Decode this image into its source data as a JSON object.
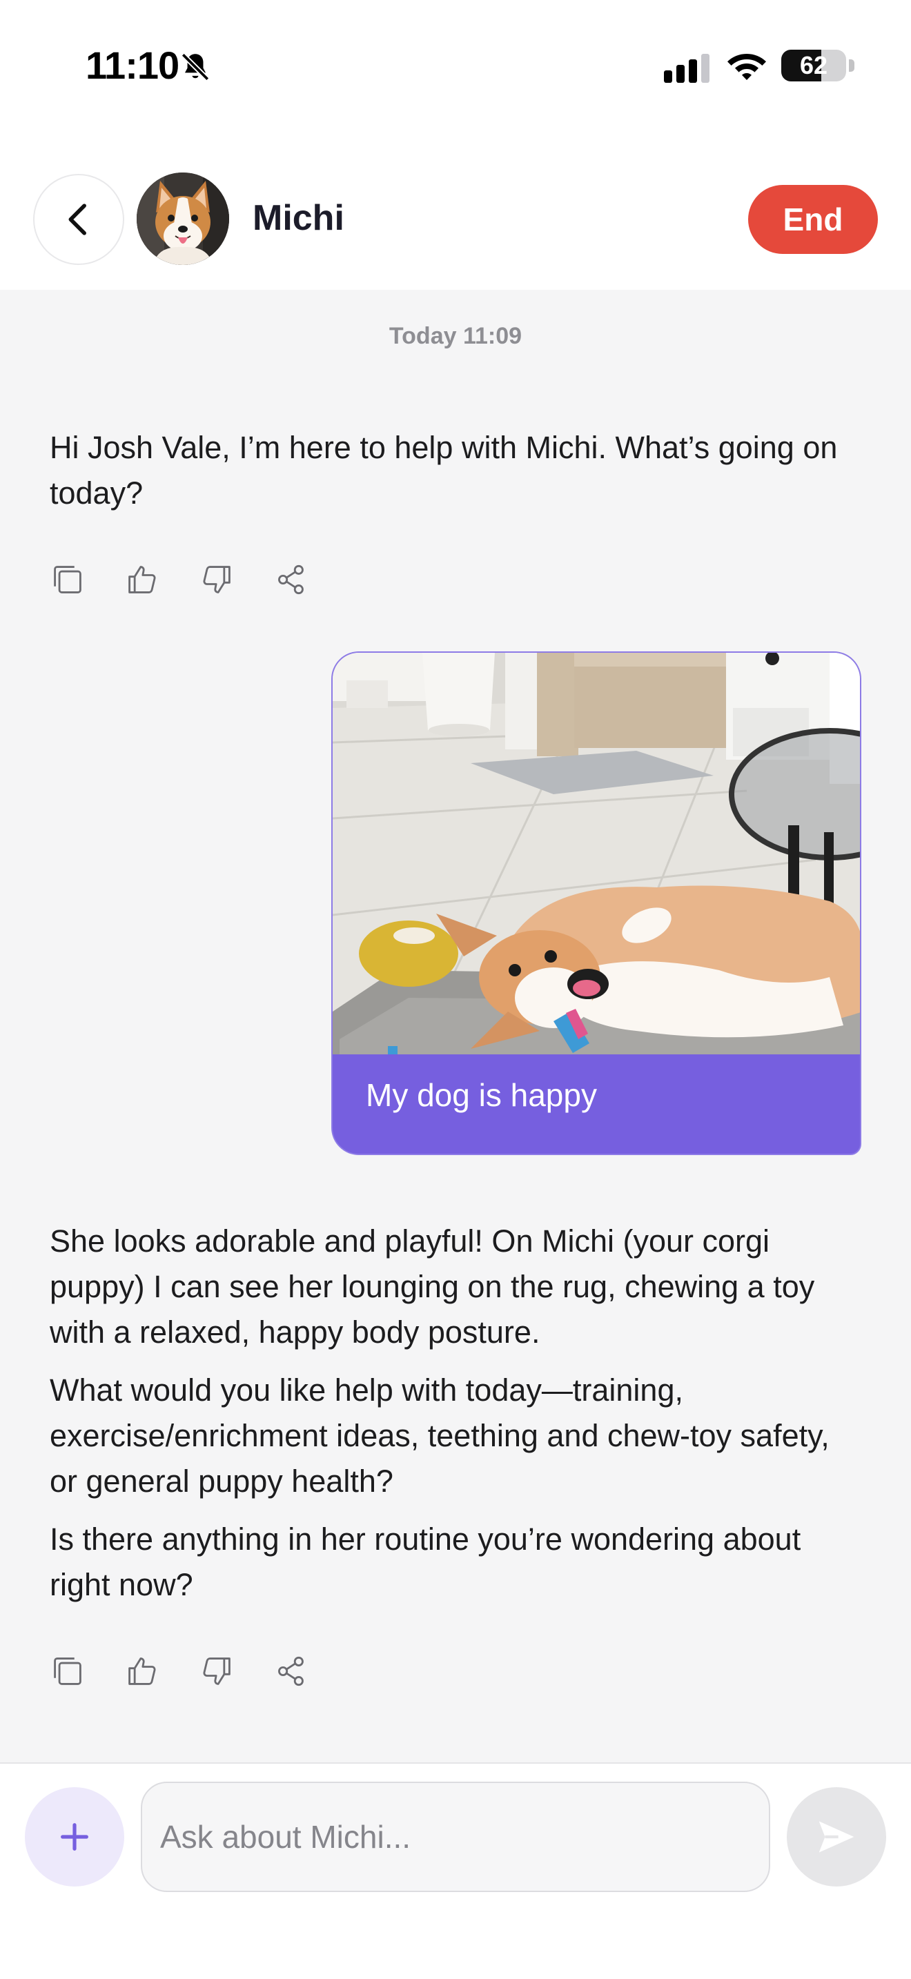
{
  "status_bar": {
    "time": "11:10",
    "battery_percent": 62,
    "battery_label": "62",
    "icons": [
      "bell-slash-icon",
      "cellular-signal-icon",
      "wifi-icon",
      "battery-icon"
    ]
  },
  "header": {
    "title": "Michi",
    "end_label": "End",
    "icons": [
      "chevron-left-icon",
      "avatar"
    ]
  },
  "chat": {
    "timestamp": "Today 11:09",
    "messages": [
      {
        "role": "assistant",
        "paragraphs": [
          "Hi Josh Vale, I’m here to help with Michi. What’s going on today?"
        ]
      },
      {
        "role": "user",
        "image": "photo of corgi puppy lying on a rug chewing a toy",
        "text": "My dog is happy"
      },
      {
        "role": "assistant",
        "paragraphs": [
          "She looks adorable and playful! On Michi (your corgi puppy) I can see her lounging on the rug, chewing a toy with a relaxed, happy body posture.",
          "What would you like help with today—training, exercise/enrichment ideas, teething and chew-toy safety, or general puppy health?",
          "Is there anything in her routine you’re wondering about right now?"
        ]
      }
    ],
    "action_icons": [
      "copy-icon",
      "thumbs-up-icon",
      "thumbs-down-icon",
      "share-icon"
    ]
  },
  "composer": {
    "placeholder": "Ask about Michi...",
    "value": "",
    "icons": [
      "plus-icon",
      "send-icon"
    ]
  },
  "colors": {
    "accent": "#765fdf",
    "end_button": "#e5493b",
    "chat_background": "#f5f5f6"
  }
}
